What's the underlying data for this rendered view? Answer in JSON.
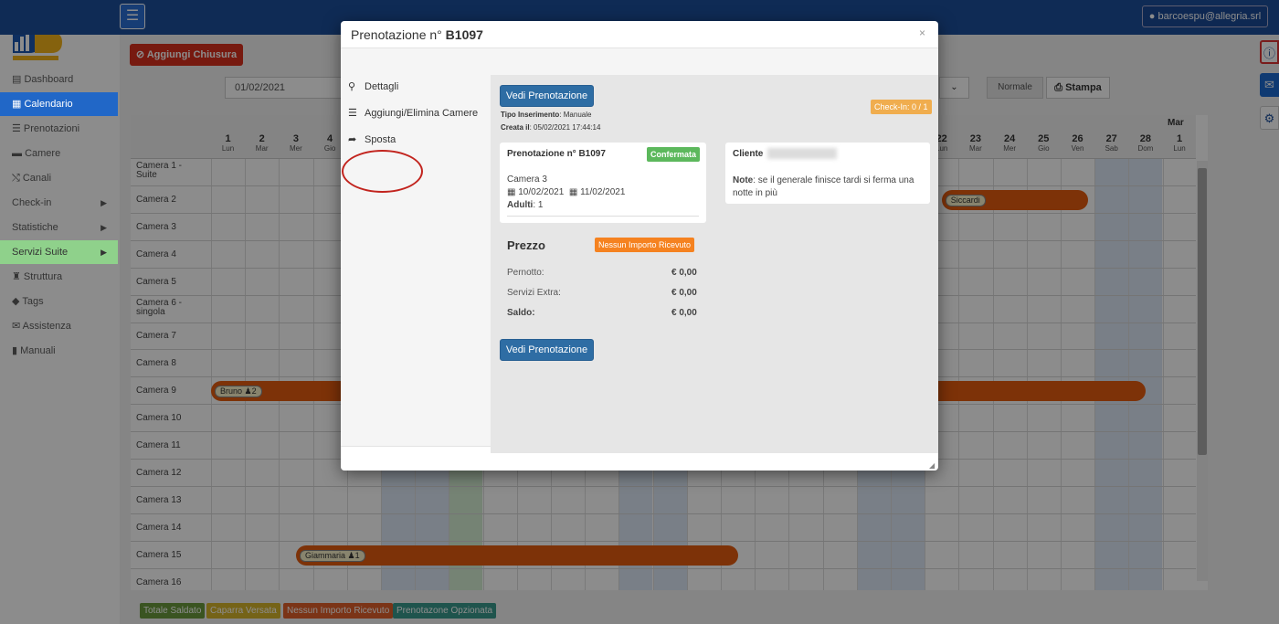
{
  "topbar": {
    "menu_icon": "☰",
    "user": "barcoespu@allegria.srl",
    "user_icon": "user-icon"
  },
  "sidebar": {
    "items": [
      {
        "label": "Dashboard",
        "icon": "▤"
      },
      {
        "label": "Calendario",
        "icon": "▦"
      },
      {
        "label": "Prenotazioni",
        "icon": "☰"
      },
      {
        "label": "Camere",
        "icon": "▬"
      },
      {
        "label": "Canali",
        "icon": "⤭"
      },
      {
        "label": "Check-in",
        "icon": ""
      },
      {
        "label": "Statistiche",
        "icon": ""
      },
      {
        "label": "Servizi Suite",
        "icon": ""
      },
      {
        "label": "Struttura",
        "icon": "♜"
      },
      {
        "label": "Tags",
        "icon": "◆"
      },
      {
        "label": "Assistenza",
        "icon": "✉"
      },
      {
        "label": "Manuali",
        "icon": "▮"
      }
    ]
  },
  "toolbar": {
    "chiusura_label": "Aggiungi Chiusura",
    "date_value": "01/02/2021",
    "normale_label": "Normale",
    "stampa_label": "Stampa"
  },
  "calendar": {
    "month_right": "Mar",
    "days_left": [
      {
        "n": "1",
        "d": "Lun"
      },
      {
        "n": "2",
        "d": "Mar"
      },
      {
        "n": "3",
        "d": "Mer"
      },
      {
        "n": "4",
        "d": "Gio"
      }
    ],
    "days_right": [
      {
        "n": "22",
        "d": "Lun"
      },
      {
        "n": "23",
        "d": "Mar"
      },
      {
        "n": "24",
        "d": "Mer"
      },
      {
        "n": "25",
        "d": "Gio"
      },
      {
        "n": "26",
        "d": "Ven"
      },
      {
        "n": "27",
        "d": "Sab"
      },
      {
        "n": "28",
        "d": "Dom"
      },
      {
        "n": "1",
        "d": "Lun"
      }
    ],
    "rooms": [
      "Camera 1 - Suite",
      "Camera 2",
      "Camera 3",
      "Camera 4",
      "Camera 5",
      "Camera 6 - singola",
      "Camera 7",
      "Camera 8",
      "Camera 9",
      "Camera 10",
      "Camera 11",
      "Camera 12",
      "Camera 13",
      "Camera 14",
      "Camera 15",
      "Camera 16"
    ],
    "bookings": [
      {
        "name": "Siccardi",
        "guests": ""
      },
      {
        "name": "Bruno",
        "guests": "2"
      },
      {
        "name": "Giammaria",
        "guests": "1"
      }
    ]
  },
  "legend": [
    {
      "label": "Totale Saldato",
      "color": "#6a9a3c"
    },
    {
      "label": "Caparra Versata",
      "color": "#d6b42a"
    },
    {
      "label": "Nessun Importo Ricevuto",
      "color": "#e0602a"
    },
    {
      "label": "Prenotazone Opzionata",
      "color": "#3a9a8c"
    }
  ],
  "modal": {
    "title_prefix": "Prenotazione n°",
    "code": "B1097",
    "close": "×",
    "tabs": [
      {
        "label": "Dettagli",
        "icon": "search-icon"
      },
      {
        "label": "Aggiungi/Elimina Camere",
        "icon": "list-icon"
      },
      {
        "label": "Sposta",
        "icon": "share-icon"
      }
    ],
    "vedi_label": "Vedi Prenotazione",
    "checkin_badge": "Check-In: 0 / 1",
    "tipo_label": "Tipo Inserimento",
    "tipo_value": ": Manuale",
    "creata_label": "Creata il",
    "creata_value": ": 05/02/2021 17:44:14",
    "booking_title": "Prenotazione n° B1097",
    "status_badge": "Confermata",
    "room": "Camera 3",
    "date_from": "10/02/2021",
    "date_to": "11/02/2021",
    "adulti_label": "Adulti",
    "adulti_value": ": 1",
    "cliente_label": "Cliente",
    "note_label": "Note",
    "note_text": ": se il generale finisce tardi si ferma una notte in più",
    "prezzo_title": "Prezzo",
    "prezzo_badge": "Nessun Importo Ricevuto",
    "pernotto_label": "Pernotto:",
    "pernotto_value": "€ 0,00",
    "extra_label": "Servizi Extra:",
    "extra_value": "€ 0,00",
    "saldo_label": "Saldo:",
    "saldo_value": "€ 0,00"
  },
  "colors": {
    "accent": "#1d4f9c",
    "booking": "#e45c10",
    "confirm": "#5cb85c",
    "checkin": "#f0ad4e"
  }
}
